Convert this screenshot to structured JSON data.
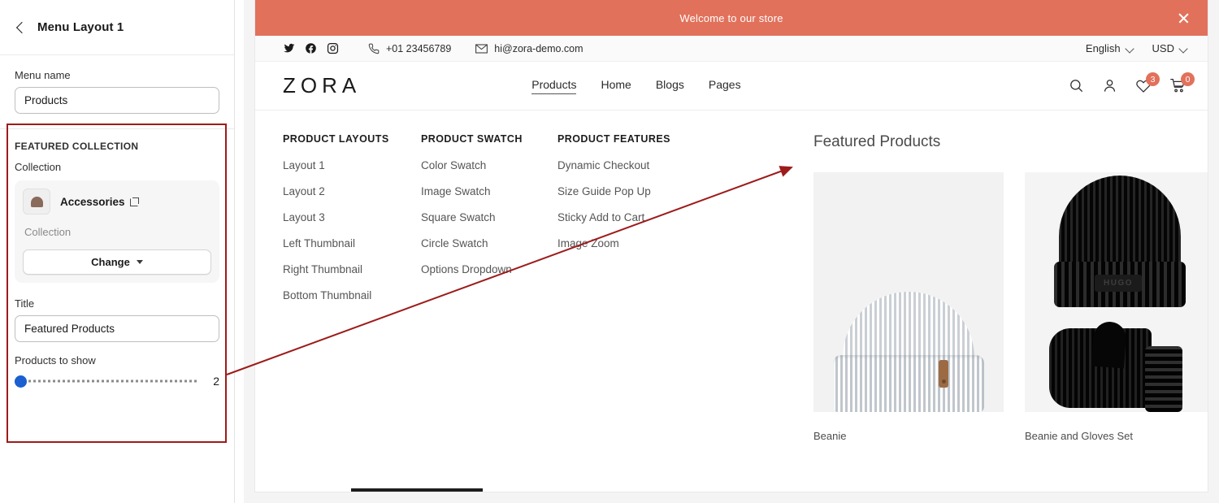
{
  "settings_panel": {
    "header": {
      "back_icon": "chevron-left-icon",
      "title": "Menu Layout 1"
    },
    "menu_name": {
      "label": "Menu name",
      "value": "Products"
    },
    "featured_collection": {
      "section_heading": "FEATURED COLLECTION",
      "collection_label": "Collection",
      "collection_name": "Accessories",
      "collection_external_icon": "external-link-icon",
      "collection_type": "Collection",
      "change_button": "Change",
      "change_caret_icon": "caret-down-icon",
      "title_label": "Title",
      "title_value": "Featured Products",
      "products_to_show_label": "Products to show",
      "products_to_show_value": "2"
    }
  },
  "annotation": {
    "box_color": "#9d1b1b",
    "arrow_color": "#9d1b1b"
  },
  "preview": {
    "announcement": {
      "text": "Welcome to our store",
      "close_icon": "close-icon",
      "bg": "#e2715b"
    },
    "utility_bar": {
      "social": [
        {
          "name": "twitter-icon"
        },
        {
          "name": "facebook-icon"
        },
        {
          "name": "instagram-icon"
        }
      ],
      "phone_icon": "phone-icon",
      "phone": "+01 23456789",
      "email_icon": "envelope-icon",
      "email": "hi@zora-demo.com",
      "language": "English",
      "currency": "USD",
      "chevron_icon": "chevron-down-icon"
    },
    "header": {
      "logo": "ZORA",
      "nav": [
        {
          "label": "Products",
          "active": true
        },
        {
          "label": "Home",
          "active": false
        },
        {
          "label": "Blogs",
          "active": false
        },
        {
          "label": "Pages",
          "active": false
        }
      ],
      "icons": [
        {
          "name": "search-icon",
          "badge": null
        },
        {
          "name": "account-icon",
          "badge": null
        },
        {
          "name": "wishlist-heart-icon",
          "badge": "3"
        },
        {
          "name": "cart-icon",
          "badge": "0"
        }
      ],
      "badge_color": "#e2715b"
    },
    "mega_menu": {
      "columns": [
        {
          "title": "PRODUCT LAYOUTS",
          "items": [
            "Layout 1",
            "Layout 2",
            "Layout 3",
            "Left Thumbnail",
            "Right Thumbnail",
            "Bottom Thumbnail"
          ]
        },
        {
          "title": "PRODUCT SWATCH",
          "items": [
            "Color Swatch",
            "Image Swatch",
            "Square Swatch",
            "Circle Swatch",
            "Options Dropdown"
          ]
        },
        {
          "title": "PRODUCT FEATURES",
          "items": [
            "Dynamic Checkout",
            "Size Guide Pop Up",
            "Sticky Add to Cart",
            "Image Zoom"
          ]
        }
      ]
    },
    "featured_products": {
      "title": "Featured Products",
      "products": [
        {
          "name": "Beanie",
          "image": "white-ribbed-beanie"
        },
        {
          "name": "Beanie and Gloves Set",
          "image": "black-beanie-and-mitten",
          "label_text": "HUGO"
        }
      ]
    }
  }
}
